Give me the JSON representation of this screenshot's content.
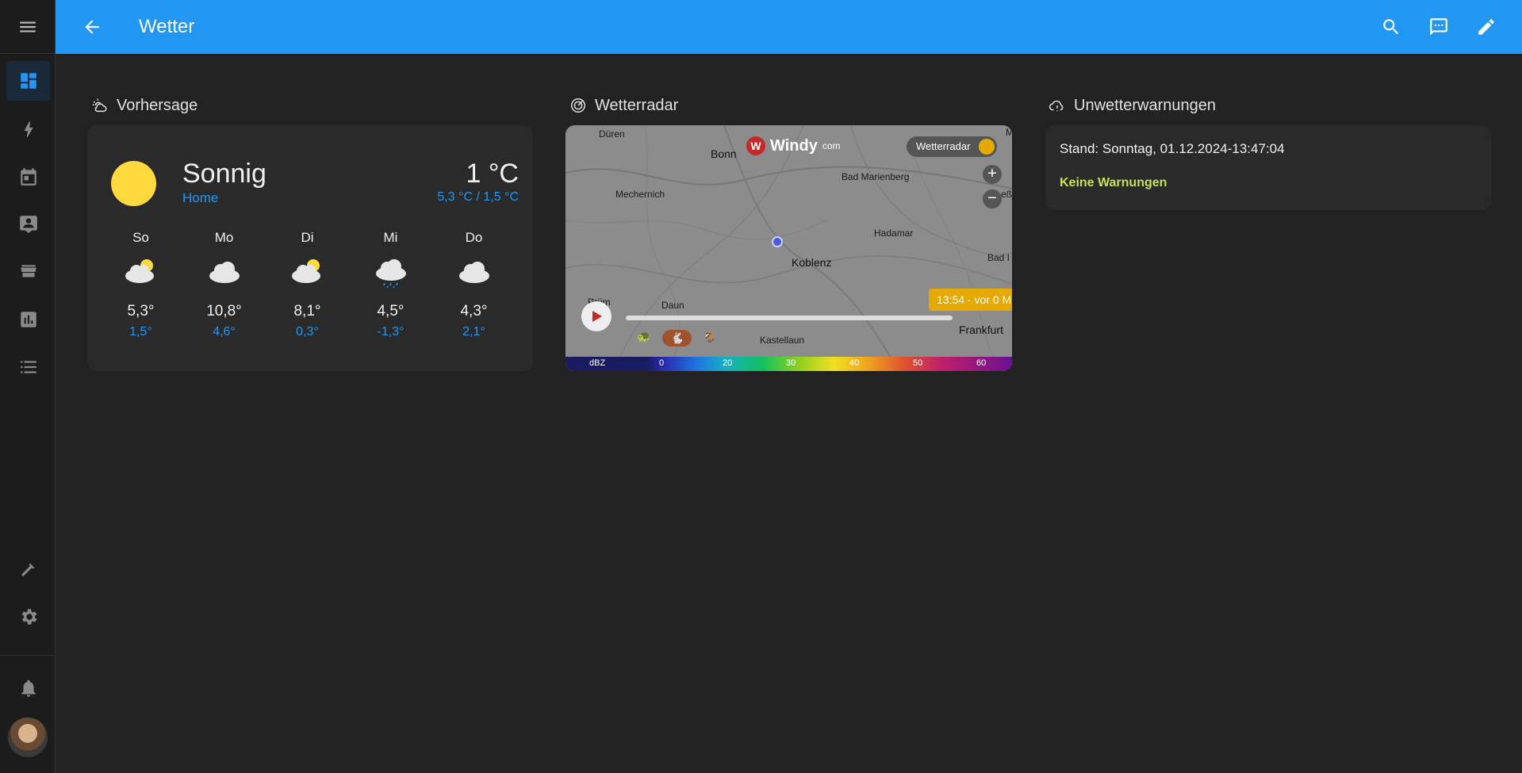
{
  "header": {
    "title": "Wetter"
  },
  "forecast": {
    "section_title": "Vorhersage",
    "condition": "Sonnig",
    "location": "Home",
    "temperature": "1 °C",
    "range": "5,3 °C / 1,5 °C",
    "days": [
      {
        "name": "So",
        "icon": "partly-cloudy-icon",
        "high": "5,3°",
        "low": "1,5°"
      },
      {
        "name": "Mo",
        "icon": "cloudy-icon",
        "high": "10,8°",
        "low": "4,6°"
      },
      {
        "name": "Di",
        "icon": "partly-cloudy-icon",
        "high": "8,1°",
        "low": "0,3°"
      },
      {
        "name": "Mi",
        "icon": "rainy-icon",
        "high": "4,5°",
        "low": "-1,3°"
      },
      {
        "name": "Do",
        "icon": "cloudy-icon",
        "high": "4,3°",
        "low": "2,1°"
      }
    ]
  },
  "radar": {
    "section_title": "Wetterradar",
    "brand": "Windy",
    "brand_suffix": "com",
    "layer_label": "Wetterradar",
    "time_label": "13:54 - vor 0 M",
    "zoom_in": "+",
    "zoom_out": "−",
    "places": {
      "dueren": "Düren",
      "bonn": "Bonn",
      "bad_marienberg": "Bad Marienberg",
      "mechernich": "Mechernich",
      "hadamar": "Hadamar",
      "koblenz": "Koblenz",
      "bad": "Bad I",
      "daun": "Daun",
      "pruem": "Prüm",
      "kastellaun": "Kastellaun",
      "frankfurt": "Frankfurt",
      "edge_m": "M",
      "edge_ess": "eß"
    },
    "legend": {
      "unit": "dBZ",
      "ticks": [
        "0",
        "20",
        "30",
        "40",
        "50",
        "60"
      ]
    }
  },
  "warnings": {
    "section_title": "Unwetterwarnungen",
    "stand": "Stand: Sonntag, 01.12.2024-13:47:04",
    "status": "Keine Warnungen"
  },
  "colors": {
    "accent": "#2196f3",
    "sun": "#fdd93d",
    "ok": "#c5e15a",
    "background": "#222222",
    "card": "#2a2a2a"
  }
}
